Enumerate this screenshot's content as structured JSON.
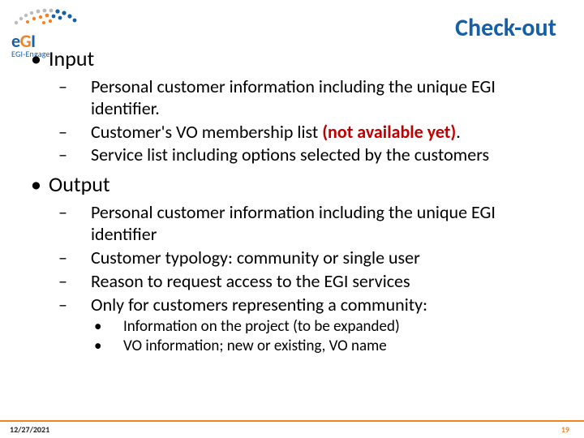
{
  "logo": {
    "brand_e": "e",
    "brand_g": "G",
    "brand_i": "I",
    "sub": "EGI-Engage"
  },
  "title": "Check-out",
  "sections": {
    "input": {
      "heading": "Input",
      "items": [
        {
          "pre": "Personal customer information including the unique EGI identifier."
        },
        {
          "pre": "Customer's VO membership list ",
          "em": "(not available yet)",
          "post": "."
        },
        {
          "pre": "Service list including options selected by the customers"
        }
      ]
    },
    "output": {
      "heading": "Output",
      "items": [
        {
          "pre": "Personal customer information including the unique EGI identifier"
        },
        {
          "pre": "Customer typology: community or single user"
        },
        {
          "pre": "Reason to request access to the EGI services"
        },
        {
          "pre": "Only for customers representing a community:"
        }
      ],
      "subitems": [
        "Information on the project (to be expanded)",
        "VO information; new or existing, VO name"
      ]
    }
  },
  "footer": {
    "date": "12/27/2021",
    "page": "19"
  }
}
